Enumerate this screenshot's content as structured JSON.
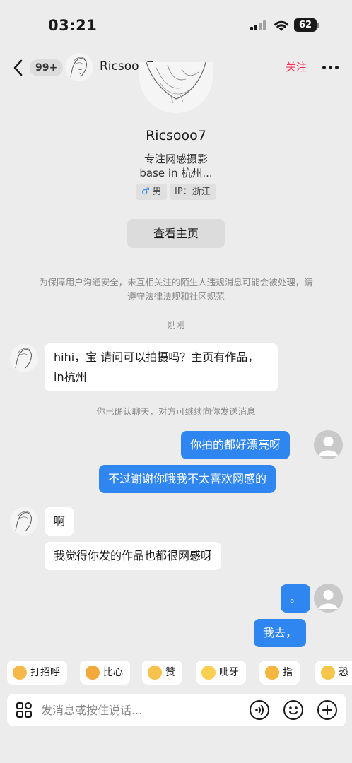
{
  "status_bar": {
    "time": "03:21",
    "battery": "62"
  },
  "nav": {
    "unread_badge": "99+",
    "username": "Ricsooo7",
    "follow_label": "关注"
  },
  "profile": {
    "name": "Ricsooo7",
    "bio_line1": "专注网感摄影",
    "bio_line2": "base in 杭州...",
    "gender_symbol": "♂",
    "gender_label": "男",
    "ip_label": "IP：浙江",
    "view_profile_label": "查看主页"
  },
  "notice": "为保障用户沟通安全，未互相关注的陌生人违规消息可能会被处理，请遵守法律法规和社区规范",
  "timestamp": "刚刚",
  "confirm_note": "你已确认聊天，对方可继续向你发送消息",
  "messages": [
    {
      "from": "them",
      "text": "hihi，宝 请问可以拍摄吗？主页有作品，in杭州"
    },
    {
      "from": "me",
      "text": "你拍的都好漂亮呀"
    },
    {
      "from": "me",
      "text": "不过谢谢你哦我不太喜欢网感的"
    },
    {
      "from": "them",
      "text": "啊"
    },
    {
      "from": "them",
      "text": "我觉得你发的作品也都很网感呀"
    },
    {
      "from": "me",
      "text": "。"
    },
    {
      "from": "me",
      "text": "我去，"
    }
  ],
  "quick_replies": [
    {
      "label": "打招呼",
      "icon": "wave-emoji-icon"
    },
    {
      "label": "比心",
      "icon": "heart-hands-emoji-icon"
    },
    {
      "label": "赞",
      "icon": "thumbs-up-emoji-icon"
    },
    {
      "label": "呲牙",
      "icon": "grin-emoji-icon"
    },
    {
      "label": "指",
      "icon": "point-emoji-icon"
    },
    {
      "label": "恐",
      "icon": "scream-emoji-icon"
    }
  ],
  "input": {
    "placeholder": "发消息或按住说话..."
  },
  "colors": {
    "accent_red": "#ff2a55",
    "bubble_blue": "#2f86f0",
    "background": "#ececec"
  }
}
